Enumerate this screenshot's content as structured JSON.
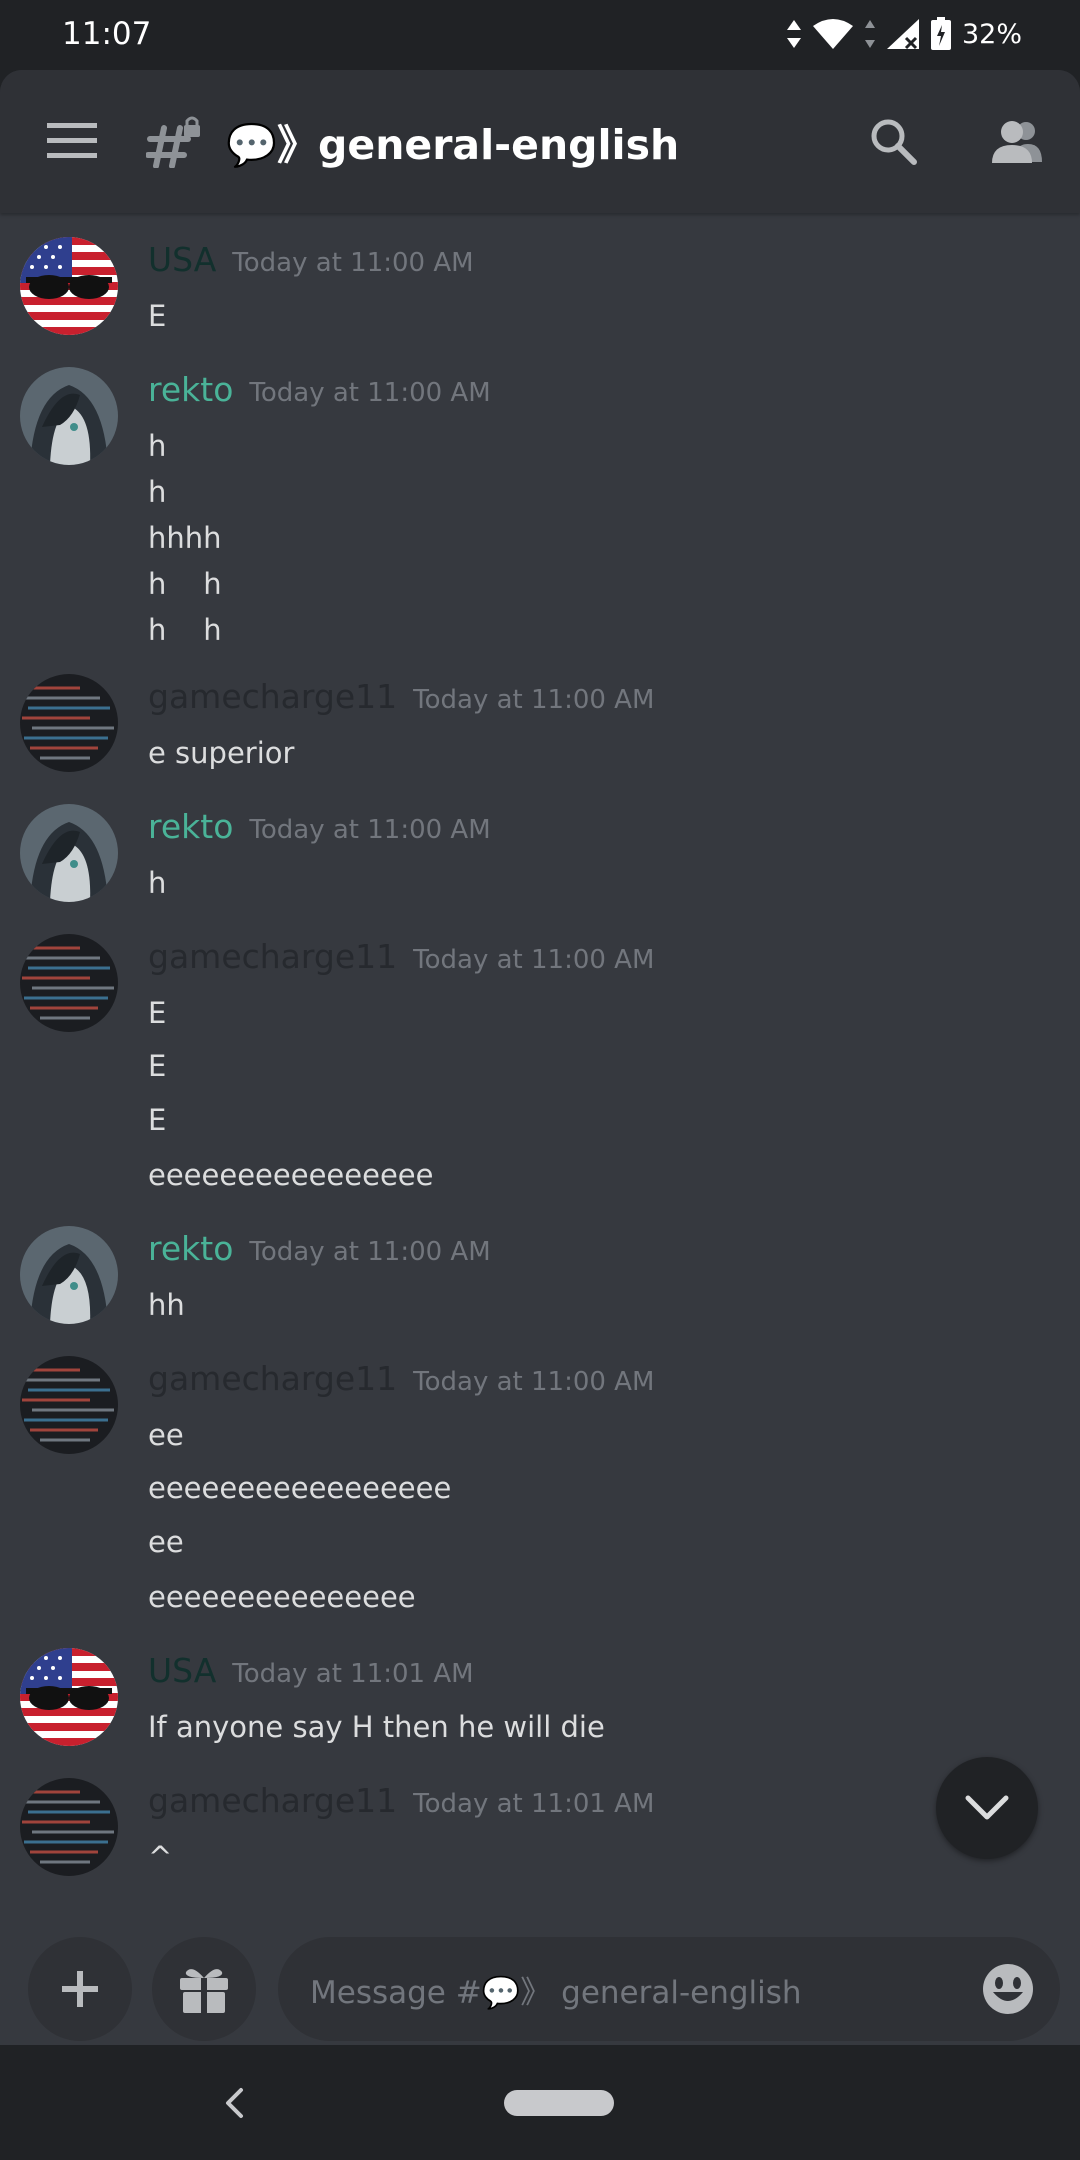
{
  "status_bar": {
    "time": "11:07",
    "battery": "32%"
  },
  "header": {
    "channel_name": "💬》general-english",
    "icons": [
      "menu-icon",
      "channel-locked-hash-icon",
      "search-icon",
      "members-icon"
    ]
  },
  "messages": [
    {
      "author": "USA",
      "time": "Today at 11:00 AM",
      "lines": [
        "E"
      ]
    },
    {
      "author": "rekto",
      "time": "Today at 11:00 AM",
      "lines": [
        "h",
        "h",
        "hhhh",
        "h    h",
        "h    h"
      ]
    },
    {
      "author": "gamecharge11",
      "time": "Today at 11:00 AM",
      "lines": [
        "e superior"
      ]
    },
    {
      "author": "rekto",
      "time": "Today at 11:00 AM",
      "lines": [
        "h"
      ]
    },
    {
      "author": "gamecharge11",
      "time": "Today at 11:00 AM",
      "lines": [
        "E",
        "E",
        "E",
        "eeeeeeeeeeeeeeee"
      ]
    },
    {
      "author": "rekto",
      "time": "Today at 11:00 AM",
      "lines": [
        "hh"
      ]
    },
    {
      "author": "gamecharge11",
      "time": "Today at 11:00 AM",
      "lines": [
        "ee",
        "eeeeeeeeeeeeeeeee",
        "ee",
        "eeeeeeeeeeeeeee"
      ]
    },
    {
      "author": "USA",
      "time": "Today at 11:01 AM",
      "lines": [
        "If anyone say H then he will die"
      ]
    },
    {
      "author": "gamecharge11",
      "time": "Today at 11:01 AM",
      "lines": [
        "^"
      ]
    }
  ],
  "composer": {
    "placeholder": "Message #💬》 general-english"
  },
  "colors": {
    "usa": "#12302d",
    "rekto": "#4ab398",
    "gamecharge11": "#26292e",
    "background": "#36393f",
    "header": "#2f3136"
  }
}
